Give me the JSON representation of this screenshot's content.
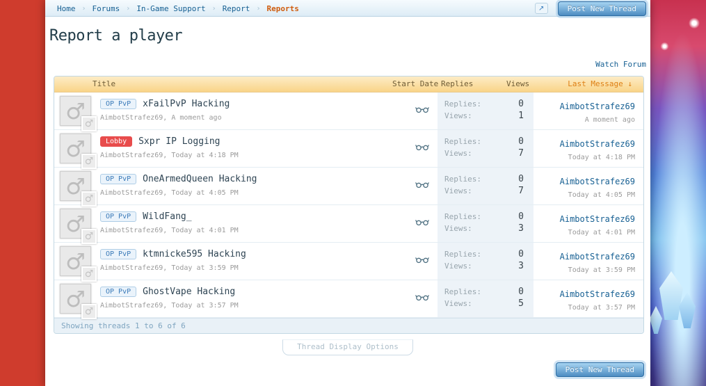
{
  "colors": {
    "link_blue": "#176093",
    "crumb_active": "#cf5c0e",
    "page_title": "#223d49",
    "table_header_top": "#fdecc6",
    "table_header_bottom": "#f9d488",
    "table_header_text": "#6e5c36",
    "sort_label": "#de7f13",
    "prefix_red": "#e84c4c",
    "prefix_blue": "#3a7ab8",
    "btn_top": "#a6d3f1",
    "btn_bottom": "#4e8dc2",
    "btn_border": "#2d6da3",
    "btn_text": "#eef8ff",
    "stats_bg": "#edf3f8",
    "footer_text": "#7fa5c0"
  },
  "icons": {
    "male_avatar": "♂",
    "share": "↗",
    "breadcrumb_separator": "›"
  },
  "breadcrumb": {
    "items": [
      {
        "label": "Home",
        "active": false
      },
      {
        "label": "Forums",
        "active": false
      },
      {
        "label": "In-Game Support",
        "active": false
      },
      {
        "label": "Report",
        "active": false
      },
      {
        "label": "Reports",
        "active": true
      }
    ]
  },
  "header": {
    "post_new_thread": "Post New Thread",
    "page_title": "Report a player",
    "watch_forum": "Watch Forum"
  },
  "table": {
    "headers": {
      "title": "Title",
      "start_date": "Start Date",
      "replies": "Replies",
      "views": "Views",
      "last_message": "Last Message ↓"
    },
    "row_labels": {
      "replies": "Replies:",
      "views": "Views:"
    },
    "threads": [
      {
        "prefix": "OP PvP",
        "prefix_style": "blue",
        "title": "xFailPvP Hacking",
        "author_line": "AimbotStrafez69, A moment ago",
        "replies": "0",
        "views": "1",
        "last_author": "AimbotStrafez69",
        "last_date": "A moment ago"
      },
      {
        "prefix": "Lobby",
        "prefix_style": "red",
        "title": "Sxpr IP Logging",
        "author_line": "AimbotStrafez69, Today at 4:18 PM",
        "replies": "0",
        "views": "7",
        "last_author": "AimbotStrafez69",
        "last_date": "Today at 4:18 PM"
      },
      {
        "prefix": "OP PvP",
        "prefix_style": "blue",
        "title": "OneArmedQueen Hacking",
        "author_line": "AimbotStrafez69, Today at 4:05 PM",
        "replies": "0",
        "views": "7",
        "last_author": "AimbotStrafez69",
        "last_date": "Today at 4:05 PM"
      },
      {
        "prefix": "OP PvP",
        "prefix_style": "blue",
        "title": "WildFang_",
        "author_line": "AimbotStrafez69, Today at 4:01 PM",
        "replies": "0",
        "views": "3",
        "last_author": "AimbotStrafez69",
        "last_date": "Today at 4:01 PM"
      },
      {
        "prefix": "OP PvP",
        "prefix_style": "blue",
        "title": "ktmnicke595 Hacking",
        "author_line": "AimbotStrafez69, Today at 3:59 PM",
        "replies": "0",
        "views": "3",
        "last_author": "AimbotStrafez69",
        "last_date": "Today at 3:59 PM"
      },
      {
        "prefix": "OP PvP",
        "prefix_style": "blue",
        "title": "GhostVape Hacking",
        "author_line": "AimbotStrafez69, Today at 3:57 PM",
        "replies": "0",
        "views": "5",
        "last_author": "AimbotStrafez69",
        "last_date": "Today at 3:57 PM"
      }
    ],
    "footer": "Showing threads 1 to 6 of 6"
  },
  "bottom": {
    "thread_display_options": "Thread Display Options",
    "post_new_thread": "Post New Thread"
  }
}
